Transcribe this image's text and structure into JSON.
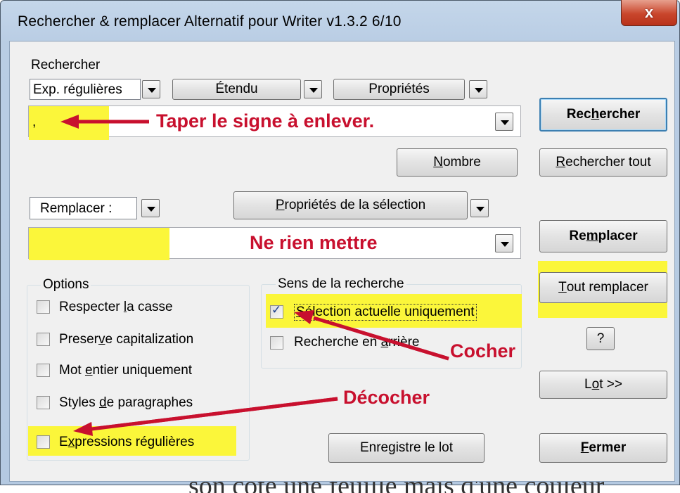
{
  "window": {
    "title": "Rechercher & remplacer Alternatif pour Writer v1.3.2  6/10",
    "close_label": "x"
  },
  "search": {
    "section_label": "Rechercher",
    "mode_select": "Exp. régulières",
    "extended_label": "Étendu",
    "properties_label": "Propriétés",
    "value": ","
  },
  "replace": {
    "mode_select": "Remplacer :",
    "selection_properties_label": "Propriétés de la sélection",
    "value": ""
  },
  "buttons": {
    "search": [
      "Rec",
      "h",
      "ercher"
    ],
    "search_all": [
      "R",
      "e",
      "chercher tout"
    ],
    "count": [
      "",
      "N",
      "ombre"
    ],
    "replace": [
      "Re",
      "m",
      "placer"
    ],
    "replace_all": [
      "",
      "T",
      "out remplacer"
    ],
    "help": "?",
    "batch": [
      "L",
      "o",
      "t >>"
    ],
    "save_batch": [
      "Enre",
      "g",
      "istre le lot"
    ],
    "close": [
      "",
      "F",
      "ermer"
    ]
  },
  "options": {
    "legend": "Options",
    "items": [
      {
        "pre": "Respecter ",
        "u": "l",
        "post": "a casse",
        "checked": false
      },
      {
        "pre": "Preser",
        "u": "v",
        "post": "e capitalization",
        "checked": false
      },
      {
        "pre": "Mot ",
        "u": "e",
        "post": "ntier uniquement",
        "checked": false
      },
      {
        "pre": "Styles ",
        "u": "d",
        "post": "e paragraphes",
        "checked": false
      },
      {
        "pre": "E",
        "u": "x",
        "post": "pressions régulières",
        "checked": false
      }
    ]
  },
  "direction": {
    "legend": "Sens de la recherche",
    "items": [
      {
        "pre": "",
        "u": "S",
        "post": "élection actuelle uniquement",
        "checked": true
      },
      {
        "pre": "Recherche en ",
        "u": "a",
        "post": "rrière",
        "checked": false
      }
    ]
  },
  "annotations": {
    "type_sign": "Taper le signe à enlever.",
    "leave_empty": "Ne rien mettre",
    "check": "Cocher",
    "uncheck": "Décocher",
    "color": "#c8102e"
  },
  "background_text": "son coté une feuille mais d'une couleur"
}
